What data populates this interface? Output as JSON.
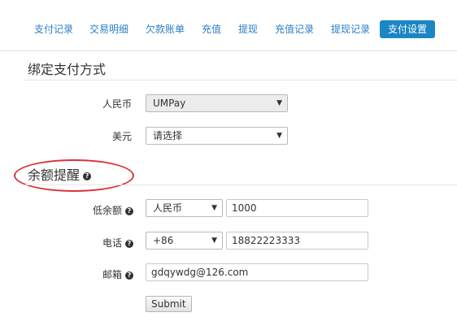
{
  "tabs": [
    {
      "label": "支付记录",
      "active": false
    },
    {
      "label": "交易明细",
      "active": false
    },
    {
      "label": "欠款账单",
      "active": false
    },
    {
      "label": "充值",
      "active": false
    },
    {
      "label": "提现",
      "active": false
    },
    {
      "label": "充值记录",
      "active": false
    },
    {
      "label": "提现记录",
      "active": false
    },
    {
      "label": "支付设置",
      "active": true
    }
  ],
  "bind_payment": {
    "title": "绑定支付方式",
    "rmb": {
      "label": "人民币",
      "value": "UMPay"
    },
    "usd": {
      "label": "美元",
      "value": "请选择"
    }
  },
  "balance_alert": {
    "title": "余额提醒",
    "low_balance": {
      "label": "低余额",
      "currency": "人民币",
      "amount": "1000"
    },
    "phone": {
      "label": "电话",
      "country_code": "+86",
      "number": "18822223333"
    },
    "email": {
      "label": "邮箱",
      "value": "gdqywdg@126.com"
    },
    "submit_label": "Submit"
  },
  "icons": {
    "help": "help-circle-icon",
    "dropdown": "chevron-down-icon"
  },
  "colors": {
    "tab_link": "#2a7ec7",
    "tab_active_bg": "#1a86c4",
    "annotation": "#d9333a"
  }
}
